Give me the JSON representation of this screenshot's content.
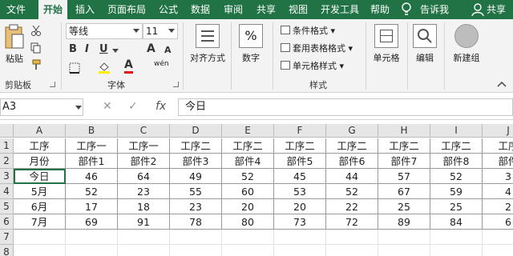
{
  "menu": [
    "文件",
    "开始",
    "插入",
    "页面布局",
    "公式",
    "数据",
    "审阅",
    "共享",
    "视图",
    "开发工具",
    "帮助"
  ],
  "tell_me": "告诉我",
  "share": "共享",
  "ribbon": {
    "paste": "粘贴",
    "clipboard": "剪贴板",
    "font_name": "等线",
    "font_size": "11",
    "bold": "B",
    "italic": "I",
    "underline": "U",
    "font_color_glyph": "A",
    "font_increase": "A",
    "font_decrease": "A",
    "phonetic": "wén",
    "font": "字体",
    "alignment": "对齐方式",
    "number": "数字",
    "number_glyph": "%",
    "cond_format": "条件格式",
    "table_format": "套用表格格式",
    "cell_style": "单元格样式",
    "styles": "样式",
    "cells": "单元格",
    "editing": "编辑",
    "new_group": "新建组"
  },
  "formula_bar": {
    "name_box": "A3",
    "fx": "fx",
    "value": "今日"
  },
  "grid": {
    "columns": [
      "A",
      "B",
      "C",
      "D",
      "E",
      "F",
      "G",
      "H",
      "I",
      "J"
    ],
    "rows": [
      "1",
      "2",
      "3",
      "4",
      "5",
      "6",
      "7",
      "8"
    ],
    "data": [
      [
        "工序",
        "工序一",
        "工序一",
        "工序二",
        "工序二",
        "工序二",
        "工序二",
        "工序二",
        "工序二",
        "工序"
      ],
      [
        "月份",
        "部件1",
        "部件2",
        "部件3",
        "部件4",
        "部件5",
        "部件6",
        "部件7",
        "部件8",
        "部件"
      ],
      [
        "今日",
        "46",
        "64",
        "49",
        "52",
        "45",
        "44",
        "57",
        "52",
        "3"
      ],
      [
        "5月",
        "52",
        "23",
        "55",
        "60",
        "53",
        "52",
        "67",
        "59",
        "4"
      ],
      [
        "6月",
        "17",
        "18",
        "23",
        "20",
        "20",
        "22",
        "25",
        "25",
        "2"
      ],
      [
        "7月",
        "69",
        "91",
        "78",
        "80",
        "73",
        "72",
        "89",
        "84",
        "6"
      ]
    ]
  },
  "colors": {
    "accent": "#217346",
    "selection": "#217346"
  }
}
